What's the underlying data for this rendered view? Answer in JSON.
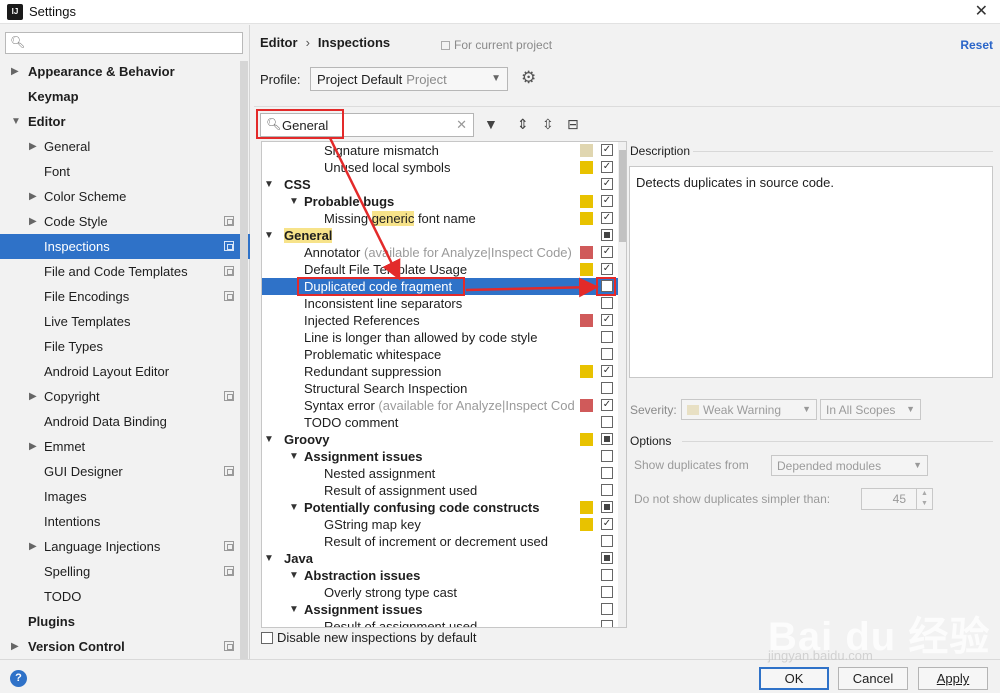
{
  "window": {
    "title": "Settings",
    "app_icon": "IJ"
  },
  "left": {
    "items": [
      {
        "label": "Appearance & Behavior",
        "level": 0,
        "arrow": "right",
        "copy": false
      },
      {
        "label": "Keymap",
        "level": 0,
        "arrow": "",
        "copy": false
      },
      {
        "label": "Editor",
        "level": 0,
        "arrow": "down",
        "copy": false
      },
      {
        "label": "General",
        "level": 1,
        "arrow": "right",
        "copy": false
      },
      {
        "label": "Font",
        "level": 1,
        "arrow": "",
        "copy": false
      },
      {
        "label": "Color Scheme",
        "level": 1,
        "arrow": "right",
        "copy": false
      },
      {
        "label": "Code Style",
        "level": 1,
        "arrow": "right",
        "copy": true
      },
      {
        "label": "Inspections",
        "level": 1,
        "arrow": "",
        "copy": true,
        "selected": true
      },
      {
        "label": "File and Code Templates",
        "level": 1,
        "arrow": "",
        "copy": true
      },
      {
        "label": "File Encodings",
        "level": 1,
        "arrow": "",
        "copy": true
      },
      {
        "label": "Live Templates",
        "level": 1,
        "arrow": "",
        "copy": false
      },
      {
        "label": "File Types",
        "level": 1,
        "arrow": "",
        "copy": false
      },
      {
        "label": "Android Layout Editor",
        "level": 1,
        "arrow": "",
        "copy": false
      },
      {
        "label": "Copyright",
        "level": 1,
        "arrow": "right",
        "copy": true
      },
      {
        "label": "Android Data Binding",
        "level": 1,
        "arrow": "",
        "copy": false
      },
      {
        "label": "Emmet",
        "level": 1,
        "arrow": "right",
        "copy": false
      },
      {
        "label": "GUI Designer",
        "level": 1,
        "arrow": "",
        "copy": true
      },
      {
        "label": "Images",
        "level": 1,
        "arrow": "",
        "copy": false
      },
      {
        "label": "Intentions",
        "level": 1,
        "arrow": "",
        "copy": false
      },
      {
        "label": "Language Injections",
        "level": 1,
        "arrow": "right",
        "copy": true
      },
      {
        "label": "Spelling",
        "level": 1,
        "arrow": "",
        "copy": true
      },
      {
        "label": "TODO",
        "level": 1,
        "arrow": "",
        "copy": false
      },
      {
        "label": "Plugins",
        "level": 0,
        "arrow": "",
        "copy": false
      },
      {
        "label": "Version Control",
        "level": 0,
        "arrow": "right",
        "copy": true
      }
    ]
  },
  "header": {
    "breadcrumb_1": "Editor",
    "breadcrumb_sep": "›",
    "breadcrumb_2": "Inspections",
    "scope_label": "For current project",
    "reset": "Reset"
  },
  "profile": {
    "label": "Profile:",
    "value": "Project Default",
    "sub": "Project"
  },
  "search": {
    "value": "General"
  },
  "tree_rows": [
    {
      "level": 2,
      "tw": "",
      "text": "Signature mismatch",
      "sev": "#e0d6b0",
      "cb": "checked"
    },
    {
      "level": 2,
      "tw": "",
      "text": "Unused local symbols",
      "sev": "#e8c200",
      "cb": "checked"
    },
    {
      "level": 0,
      "tw": "down",
      "text": "CSS",
      "bold": true,
      "sev": "",
      "cb": "checked"
    },
    {
      "level": 1,
      "tw": "down",
      "text": "Probable bugs",
      "bold": true,
      "sev": "#e8c200",
      "cb": "checked"
    },
    {
      "level": 2,
      "tw": "",
      "pre": "Missing ",
      "hl": "generic",
      "post": " font name",
      "sev": "#e8c200",
      "cb": "checked"
    },
    {
      "level": 0,
      "tw": "down",
      "hlfull": "General",
      "bold": true,
      "sev": "",
      "cb": "indeterminate"
    },
    {
      "level": 1,
      "tw": "",
      "text": "Annotator",
      "extra": " (available for Analyze|Inspect Code)",
      "sev": "#d05a5a",
      "cb": "checked"
    },
    {
      "level": 1,
      "tw": "",
      "text": "Default File Template Usage",
      "sev": "#e8c200",
      "cb": "checked"
    },
    {
      "level": 1,
      "tw": "",
      "text": "Duplicated code fragment",
      "sev": "",
      "cb": "unchecked",
      "selected": true
    },
    {
      "level": 1,
      "tw": "",
      "text": "Inconsistent line separators",
      "sev": "",
      "cb": "unchecked"
    },
    {
      "level": 1,
      "tw": "",
      "text": "Injected References",
      "sev": "#d05a5a",
      "cb": "checked"
    },
    {
      "level": 1,
      "tw": "",
      "text": "Line is longer than allowed by code style",
      "sev": "",
      "cb": "unchecked"
    },
    {
      "level": 1,
      "tw": "",
      "text": "Problematic whitespace",
      "sev": "",
      "cb": "unchecked"
    },
    {
      "level": 1,
      "tw": "",
      "text": "Redundant suppression",
      "sev": "#e8c200",
      "cb": "checked"
    },
    {
      "level": 1,
      "tw": "",
      "text": "Structural Search Inspection",
      "sev": "",
      "cb": "unchecked"
    },
    {
      "level": 1,
      "tw": "",
      "text": "Syntax error",
      "extra": " (available for Analyze|Inspect Cod",
      "sev": "#d05a5a",
      "cb": "checked"
    },
    {
      "level": 1,
      "tw": "",
      "text": "TODO comment",
      "sev": "",
      "cb": "unchecked"
    },
    {
      "level": 0,
      "tw": "down",
      "text": "Groovy",
      "bold": true,
      "sev": "#e8c200",
      "cb": "indeterminate"
    },
    {
      "level": 1,
      "tw": "down",
      "text": "Assignment issues",
      "bold": true,
      "sev": "",
      "cb": "unchecked"
    },
    {
      "level": 2,
      "tw": "",
      "text": "Nested assignment",
      "sev": "",
      "cb": "unchecked"
    },
    {
      "level": 2,
      "tw": "",
      "text": "Result of assignment used",
      "sev": "",
      "cb": "unchecked"
    },
    {
      "level": 1,
      "tw": "down",
      "text": "Potentially confusing code constructs",
      "bold": true,
      "sev": "#e8c200",
      "cb": "indeterminate"
    },
    {
      "level": 2,
      "tw": "",
      "text": "GString map key",
      "sev": "#e8c200",
      "cb": "checked"
    },
    {
      "level": 2,
      "tw": "",
      "text": "Result of increment or decrement used",
      "sev": "",
      "cb": "unchecked"
    },
    {
      "level": 0,
      "tw": "down",
      "text": "Java",
      "bold": true,
      "sev": "",
      "cb": "indeterminate"
    },
    {
      "level": 1,
      "tw": "down",
      "text": "Abstraction issues",
      "bold": true,
      "sev": "",
      "cb": "unchecked"
    },
    {
      "level": 2,
      "tw": "",
      "text": "Overly strong type cast",
      "sev": "",
      "cb": "unchecked"
    },
    {
      "level": 1,
      "tw": "down",
      "text": "Assignment issues",
      "bold": true,
      "sev": "",
      "cb": "unchecked"
    },
    {
      "level": 2,
      "tw": "",
      "text": "Result of assignment used",
      "sev": "",
      "cb": "unchecked"
    }
  ],
  "disable_new": "Disable new inspections by default",
  "description": {
    "label": "Description",
    "text": "Detects duplicates in source code."
  },
  "severity": {
    "label": "Severity:",
    "value": "Weak Warning",
    "scope": "In All Scopes"
  },
  "options": {
    "label": "Options",
    "dup_from_label": "Show duplicates from",
    "dup_from_value": "Depended modules",
    "simpler_label": "Do not show duplicates simpler than:",
    "simpler_value": "45"
  },
  "buttons": {
    "ok": "OK",
    "cancel": "Cancel",
    "apply": "Apply",
    "help": "?"
  },
  "watermark": {
    "text": "Bai du 经验",
    "url": "jingyan.baidu.com"
  },
  "colors": {
    "accent": "#2f72c8",
    "annotation_red": "#e32a2a",
    "warning_yellow": "#e8c200",
    "error_red": "#d05a5a"
  }
}
